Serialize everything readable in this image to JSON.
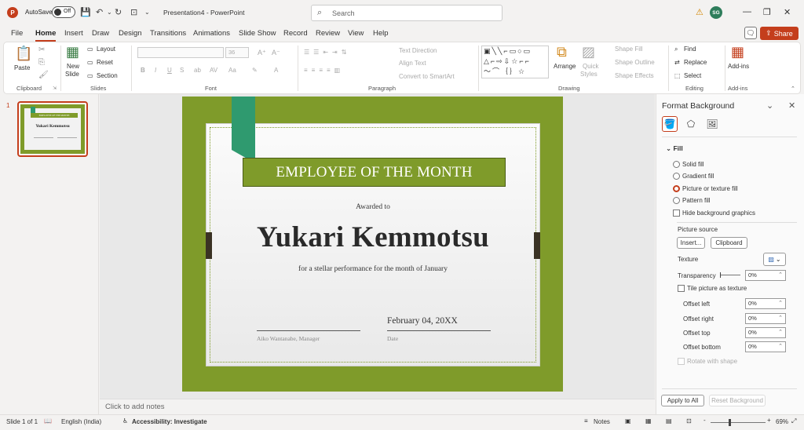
{
  "titlebar": {
    "app_letter": "P",
    "autosave_label": "AutoSave",
    "autosave_state": "Off",
    "doc_title": "Presentation4  -  PowerPoint",
    "search_placeholder": "Search",
    "user_initials": "SG",
    "icons": [
      "save-icon",
      "undo-icon",
      "redo-icon",
      "present-icon",
      "chevron-down-icon",
      "warning-icon",
      "minimize-icon",
      "restore-icon",
      "close-icon"
    ]
  },
  "menu": {
    "tabs": [
      "File",
      "Home",
      "Insert",
      "Draw",
      "Design",
      "Transitions",
      "Animations",
      "Slide Show",
      "Record",
      "Review",
      "View",
      "Help"
    ],
    "share_label": "Share"
  },
  "ribbon": {
    "clipboard": {
      "paste": "Paste",
      "label": "Clipboard"
    },
    "slides": {
      "new_slide_1": "New",
      "new_slide_2": "Slide",
      "layout": "Layout",
      "reset": "Reset",
      "section": "Section",
      "label": "Slides"
    },
    "font": {
      "size": "36",
      "bold": "B",
      "italic": "I",
      "underline": "U",
      "strike": "S",
      "label": "Font"
    },
    "paragraph": {
      "text_direction": "Text Direction",
      "align_text": "Align Text",
      "smartart": "Convert to SmartArt",
      "label": "Paragraph"
    },
    "drawing": {
      "arrange": "Arrange",
      "quick_styles_1": "Quick",
      "quick_styles_2": "Styles",
      "shape_fill": "Shape Fill",
      "shape_outline": "Shape Outline",
      "shape_effects": "Shape Effects",
      "label": "Drawing"
    },
    "editing": {
      "find": "Find",
      "replace": "Replace",
      "select": "Select",
      "label": "Editing"
    },
    "addins": {
      "addins": "Add-ins",
      "label": "Add-ins"
    }
  },
  "thumbnail": {
    "number": "1",
    "banner": "EMPLOYEE OF THE MONTH",
    "name": "Yukari Kemmotsu"
  },
  "slide": {
    "banner": "EMPLOYEE OF THE MONTH",
    "awarded_to": "Awarded to",
    "recipient": "Yukari Kemmotsu",
    "performance": "for a stellar performance for the month of January",
    "date": "February 04, 20XX",
    "signer_label": "Aiko Wantanabe, Manager",
    "date_label": "Date"
  },
  "notes_placeholder": "Click to add notes",
  "format_pane": {
    "title": "Format Background",
    "fill_header": "Fill",
    "options": [
      "Solid fill",
      "Gradient fill",
      "Picture or texture fill",
      "Pattern fill"
    ],
    "hide_graphics": "Hide background graphics",
    "picture_source": "Picture source",
    "insert_btn": "Insert...",
    "clipboard_btn": "Clipboard",
    "texture": "Texture",
    "transparency": "Transparency",
    "transparency_value": "0%",
    "tile": "Tile picture as texture",
    "offset_left": "Offset left",
    "offset_right": "Offset right",
    "offset_top": "Offset top",
    "offset_bottom": "Offset bottom",
    "offset_left_val": "0%",
    "offset_right_val": "0%",
    "offset_top_val": "0%",
    "offset_bottom_val": "0%",
    "rotate": "Rotate with shape",
    "apply_all": "Apply to All",
    "reset_bg": "Reset Background"
  },
  "statusbar": {
    "slide_count": "Slide 1 of 1",
    "language": "English (India)",
    "accessibility": "Accessibility: Investigate",
    "notes": "Notes",
    "zoom_minus": "-",
    "zoom_plus": "+",
    "zoom": "69%"
  },
  "colors": {
    "accent": "#c43e1c",
    "slide_green": "#7f9b2a",
    "ribbon_teal": "#2f9a6f"
  }
}
